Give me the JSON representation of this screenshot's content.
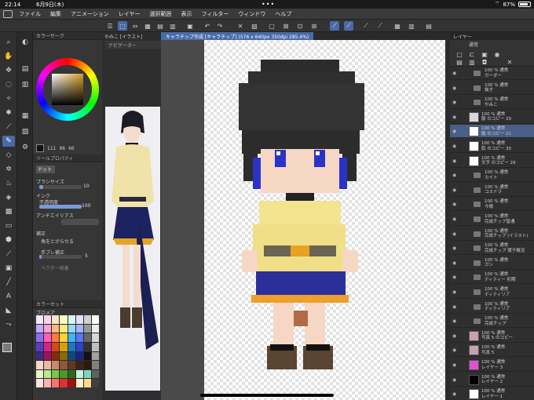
{
  "status": {
    "time": "22:14",
    "date": "6月9日(木)",
    "dots": "•••",
    "battery_pct": "87%",
    "battery_level": 0.87
  },
  "menubar": {
    "items": [
      "ファイル",
      "編集",
      "アニメーション",
      "レイヤー",
      "選択範囲",
      "表示",
      "フィルター",
      "ウィンドウ",
      "ヘルプ"
    ]
  },
  "panels": {
    "color_tab": "カラーサーク",
    "hsv_values": [
      "111",
      "96",
      "66"
    ],
    "tool_prop_title": "ツールプロパティ",
    "tool_name": "ドット",
    "brush_size_label": "ブラシサイズ",
    "brush_size_value": "10",
    "brush_size_level": 0.1,
    "ink_label": "インク",
    "opacity_label": "不透明度",
    "opacity_value": "100",
    "opacity_level": 1.0,
    "aa_label": "アンチエイリアス",
    "correction_label": "補正",
    "auto_connect_label": "角をとがらせる",
    "stabilize_label": "手ブレ補正",
    "stabilize_value": "5",
    "stabilize_level": 0.05,
    "vector_label": "ベクター吸着",
    "colorset_title": "カラーセット",
    "colorset_name": "ブロメア"
  },
  "reference": {
    "tab": "やみこ [イラスト]",
    "navigator": "ナビゲーター"
  },
  "canvas": {
    "tab_title": "キャラチップ作成 [キャラチップ] (576 x 640px 350dpi 285.4%)"
  },
  "layers": {
    "title": "レイヤー",
    "blend_mode": "通常",
    "rows": [
      {
        "type": "folder",
        "line1": "100 % 通常",
        "line2": "ガーダー"
      },
      {
        "type": "folder",
        "line1": "100 % 通常",
        "line2": "抜き"
      },
      {
        "type": "folder",
        "line1": "100 % 通常",
        "line2": "やみこ"
      },
      {
        "type": "layer",
        "line1": "100 % 通常",
        "line2": "服 のコピー 29"
      },
      {
        "type": "layer",
        "line1": "100 % 通常",
        "line2": "服 のコピー 21",
        "selected": true
      },
      {
        "type": "layer",
        "line1": "100 % 通常",
        "line2": "肌 のコピー 30"
      },
      {
        "type": "layer",
        "line1": "100 % 通常",
        "line2": "文字 のコピー 29"
      },
      {
        "type": "folder",
        "line1": "100 % 通常",
        "line2": "カイト"
      },
      {
        "type": "folder",
        "line1": "100 % 通常",
        "line2": "コスドラ"
      },
      {
        "type": "folder",
        "line1": "100 % 通常",
        "line2": "今陽"
      },
      {
        "type": "folder",
        "line1": "100 % 通常",
        "line2": "完成チップ普通"
      },
      {
        "type": "folder",
        "line1": "100 % 通常",
        "line2": "完成チップ (イラスト)"
      },
      {
        "type": "folder",
        "line1": "100 % 通常",
        "line2": "完成チップ 競子概況"
      },
      {
        "type": "folder",
        "line1": "100 % 通常",
        "line2": "ガン"
      },
      {
        "type": "folder",
        "line1": "100 % 通常",
        "line2": "ディティー 初期"
      },
      {
        "type": "folder",
        "line1": "100 % 通常",
        "line2": "ディティリア"
      },
      {
        "type": "folder",
        "line1": "100 % 通常",
        "line2": "ディティリア"
      },
      {
        "type": "folder",
        "line1": "100 % 通常",
        "line2": "完成チップ"
      },
      {
        "type": "layer",
        "line1": "100 % 通常",
        "line2": "写真 5 のコピー"
      },
      {
        "type": "layer",
        "line1": "100 % 通常",
        "line2": "写真 5"
      },
      {
        "type": "layer",
        "line1": "100 % 通常",
        "line2": "レイヤー 3"
      },
      {
        "type": "layer",
        "line1": "100 % 通常",
        "line2": "レイヤー 2"
      },
      {
        "type": "layer",
        "line1": "100 % 通常",
        "line2": "レイヤー 1"
      }
    ]
  },
  "colors": {
    "accent": "#4a6aa8",
    "skin": "#f6d7c3",
    "hair": "#2a2a2a",
    "eye_blue": "#2b32c8",
    "dress": "#f3e58f",
    "skirt": "#2c2f9a"
  }
}
